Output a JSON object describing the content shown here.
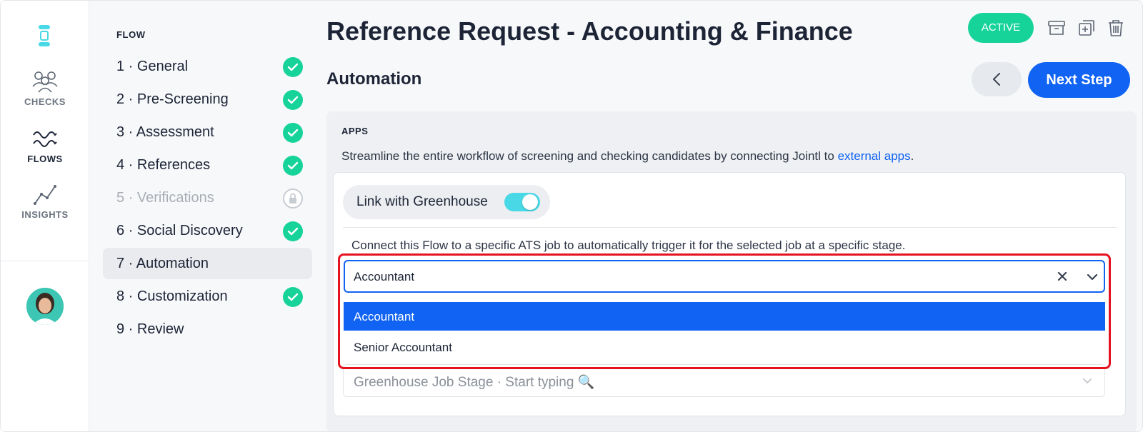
{
  "rail": {
    "items": [
      {
        "label": "CHECKS",
        "icon": "people-icon"
      },
      {
        "label": "FLOWS",
        "icon": "waves-icon"
      },
      {
        "label": "INSIGHTS",
        "icon": "trend-icon"
      }
    ]
  },
  "flow": {
    "title": "FLOW",
    "steps": [
      {
        "label": "1 · General",
        "status": "done"
      },
      {
        "label": "2 · Pre-Screening",
        "status": "done"
      },
      {
        "label": "3 · Assessment",
        "status": "done"
      },
      {
        "label": "4 · References",
        "status": "done"
      },
      {
        "label": "5 · Verifications",
        "status": "locked"
      },
      {
        "label": "6 · Social Discovery",
        "status": "done"
      },
      {
        "label": "7 · Automation",
        "status": "current"
      },
      {
        "label": "8 · Customization",
        "status": "done"
      },
      {
        "label": "9 · Review",
        "status": "pending"
      }
    ]
  },
  "header": {
    "title": "Reference Request - Accounting & Finance",
    "status_badge": "ACTIVE",
    "section_title": "Automation",
    "next_button": "Next Step"
  },
  "apps": {
    "label": "APPS",
    "description": "Streamline the entire workflow of screening and checking candidates by connecting Jointl to ",
    "link_text": "external apps",
    "description_end": "."
  },
  "integration": {
    "toggle_label": "Link with Greenhouse",
    "toggle_on": true,
    "connect_text": "Connect this Flow to a specific ATS job to automatically trigger it for the selected job at a specific stage.",
    "job_select_value": "Accountant",
    "job_options": [
      "Accountant",
      "Senior Accountant"
    ],
    "stage_placeholder": "Greenhouse Job Stage · Start typing 🔍"
  },
  "colors": {
    "accent": "#1063f3",
    "success": "#16d39a",
    "toggle": "#48d8e6",
    "highlight": "#e5131f"
  }
}
